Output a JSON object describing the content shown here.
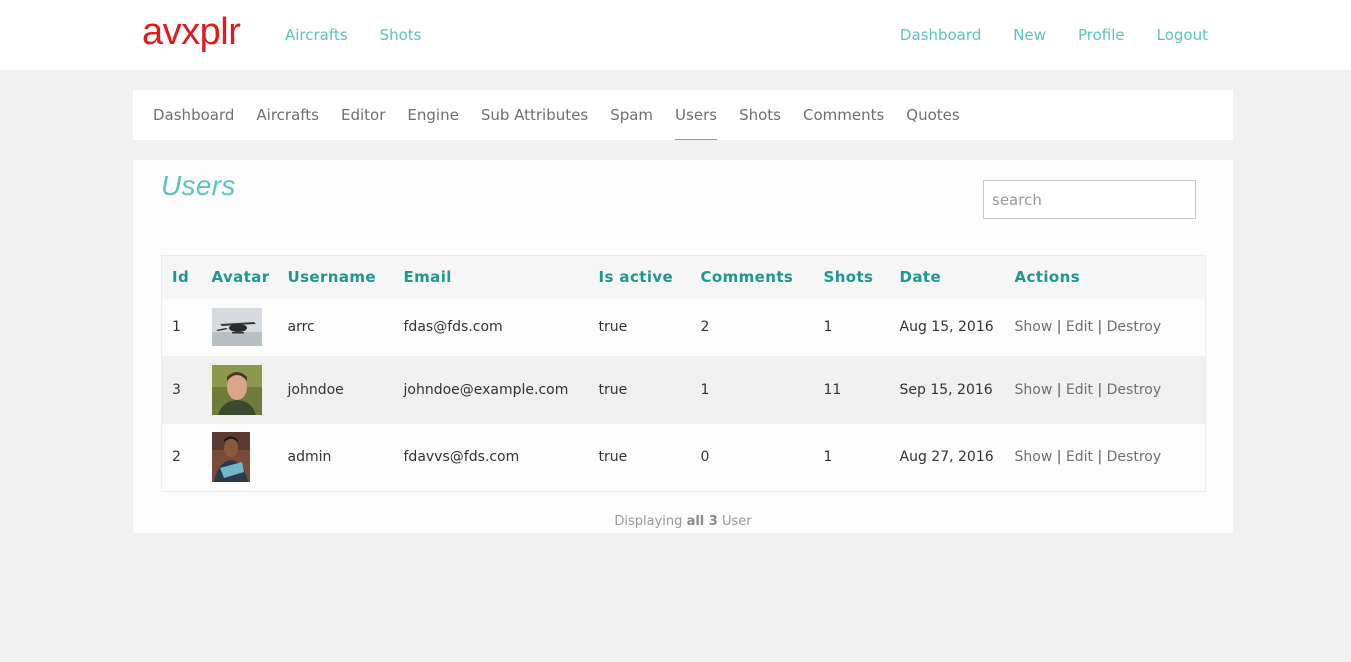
{
  "brand": {
    "logo": "avxplr",
    "logo_color": "#e01b1b",
    "accent": "#5bc4bd",
    "header_color": "#1f9690"
  },
  "topnav": {
    "left": [
      "Aircrafts",
      "Shots"
    ],
    "right": [
      "Dashboard",
      "New",
      "Profile",
      "Logout"
    ]
  },
  "subnav": {
    "items": [
      "Dashboard",
      "Aircrafts",
      "Editor",
      "Engine",
      "Sub Attributes",
      "Spam",
      "Users",
      "Shots",
      "Comments",
      "Quotes"
    ],
    "active": "Users"
  },
  "page": {
    "title": "Users",
    "search_placeholder": "search"
  },
  "table": {
    "headers": [
      "Id",
      "Avatar",
      "Username",
      "Email",
      "Is active",
      "Comments",
      "Shots",
      "Date",
      "Actions"
    ],
    "rows": [
      {
        "id": "1",
        "avatar": "helicopter-photo",
        "username": "arrc",
        "email": "fdas@fds.com",
        "is_active": "true",
        "comments": "2",
        "shots": "1",
        "date": "Aug 15, 2016"
      },
      {
        "id": "3",
        "avatar": "man-portrait-photo",
        "username": "johndoe",
        "email": "johndoe@example.com",
        "is_active": "true",
        "comments": "1",
        "shots": "11",
        "date": "Sep 15, 2016"
      },
      {
        "id": "2",
        "avatar": "person-photo",
        "username": "admin",
        "email": "fdavvs@fds.com",
        "is_active": "true",
        "comments": "0",
        "shots": "1",
        "date": "Aug 27, 2016"
      }
    ],
    "actions": {
      "show": "Show",
      "edit": "Edit",
      "destroy": "Destroy",
      "separator": "|"
    }
  },
  "footer": {
    "prefix": "Displaying",
    "bold": "all 3",
    "suffix": "User"
  }
}
